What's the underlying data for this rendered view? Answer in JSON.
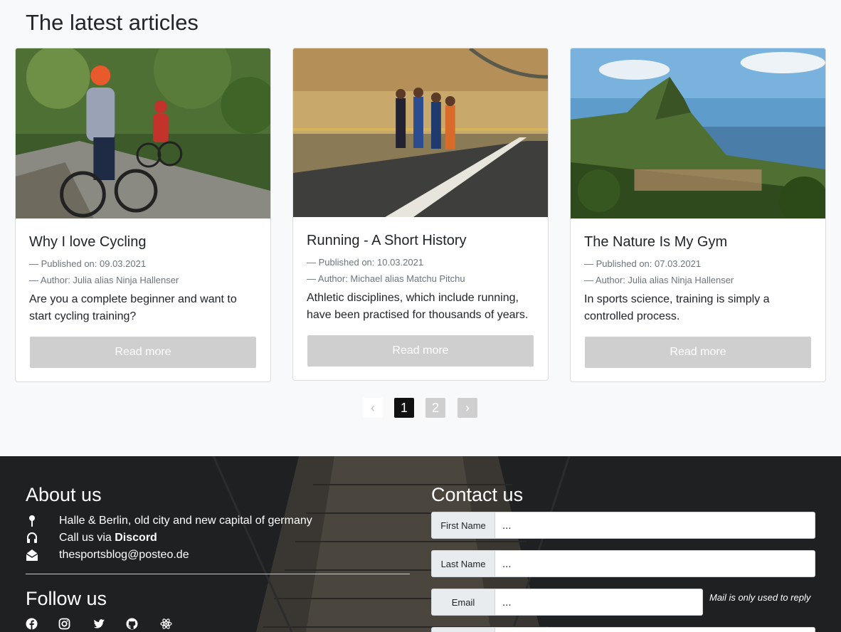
{
  "section_title": "The latest articles",
  "articles": [
    {
      "title": "Why I love Cycling",
      "published": "— Published on: 09.03.2021",
      "author": "— Author: Julia alias Ninja Hallenser",
      "description": "Are you a complete beginner and want to start cycling training?",
      "button": "Read more"
    },
    {
      "title": "Running - A Short History",
      "published": "— Published on: 10.03.2021",
      "author": "— Author: Michael alias Matchu Pitchu",
      "description": "Athletic disciplines, which include running, have been practised for thousands of years.",
      "button": "Read more"
    },
    {
      "title": "The Nature Is My Gym",
      "published": "— Published on: 07.03.2021",
      "author": "— Author: Julia alias Ninja Hallenser",
      "description": "In sports science, training is simply a controlled process.",
      "button": "Read more"
    }
  ],
  "pagination": {
    "prev": "‹",
    "pages": [
      "1",
      "2"
    ],
    "active_page": "1",
    "next": "›"
  },
  "footer": {
    "about_title": "About us",
    "location": "Halle & Berlin, old city and new capital of germany",
    "call_prefix": "Call us via ",
    "call_link": "Discord",
    "email": "thesportsblog@posteo.de",
    "follow_title": "Follow us",
    "social_icons": [
      "facebook-icon",
      "instagram-icon",
      "twitter-icon",
      "github-icon",
      "react-icon"
    ],
    "contact_title": "Contact us",
    "fields": [
      {
        "label": "First Name",
        "value": "..."
      },
      {
        "label": "Last Name",
        "value": "..."
      },
      {
        "label": "Email",
        "value": "..."
      }
    ],
    "email_note": "Mail is only used to reply"
  },
  "colors": {
    "button_bg": "#cfcfcf",
    "active_page_bg": "#111111",
    "footer_bg": "#1e1f21"
  }
}
